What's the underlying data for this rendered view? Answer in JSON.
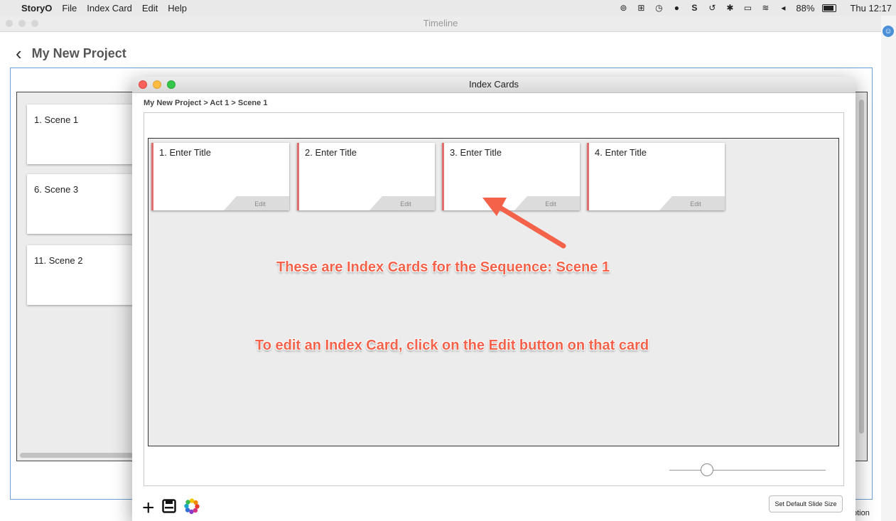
{
  "menubar": {
    "app_name": "StoryO",
    "menus": [
      "File",
      "Index Card",
      "Edit",
      "Help"
    ],
    "battery": "88%",
    "clock": "Thu 12:17"
  },
  "timeline_window": {
    "title": "Timeline",
    "project_title": "My New Project",
    "scenes": [
      "1. Scene 1",
      "6. Scene 3",
      "11. Scene 2"
    ]
  },
  "index_window": {
    "title": "Index Cards",
    "breadcrumb": "My New Project > Act 1 > Scene 1",
    "cards": [
      {
        "title": "1. Enter Title",
        "edit_label": "Edit"
      },
      {
        "title": "2. Enter Title",
        "edit_label": "Edit"
      },
      {
        "title": "3. Enter Title",
        "edit_label": "Edit"
      },
      {
        "title": "4. Enter Title",
        "edit_label": "Edit"
      }
    ],
    "annotation_1": "These are Index Cards for the Sequence: Scene 1",
    "annotation_2": "To edit an Index Card, click on the Edit button on that card",
    "default_size_button": "Set Default Slide Size"
  },
  "partial_text": "ption",
  "colors": {
    "annotation": "#f4624a",
    "frame_blue": "#6ba0d6",
    "card_accent": "#e07070"
  }
}
